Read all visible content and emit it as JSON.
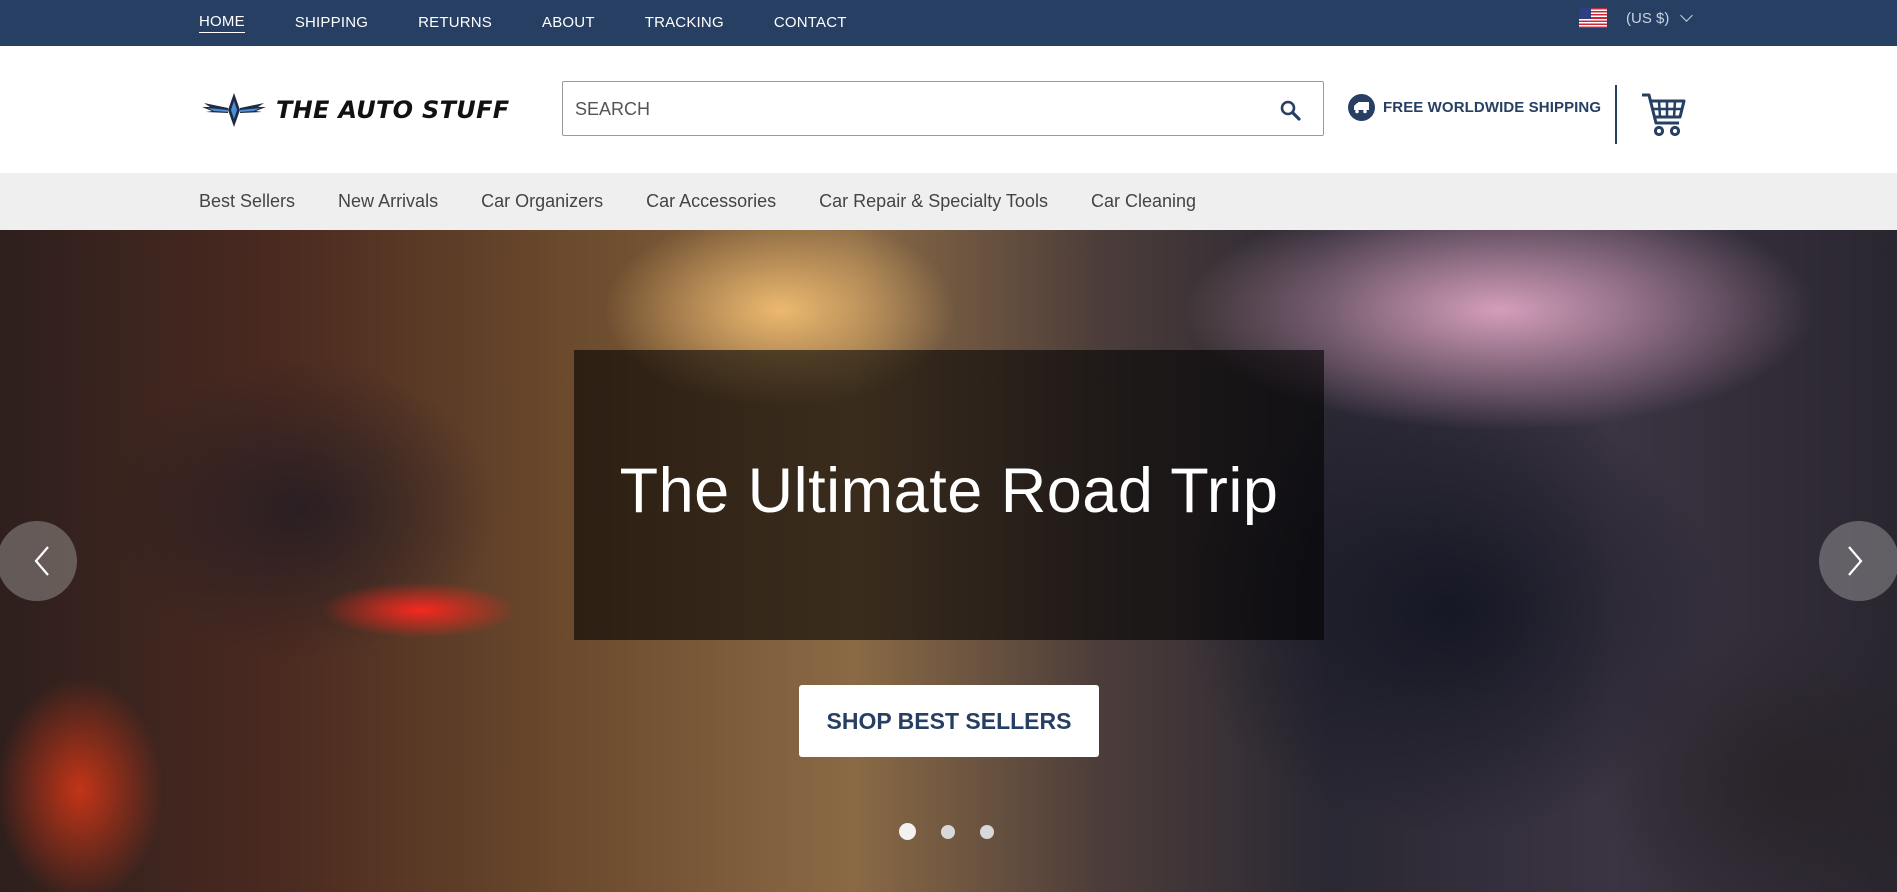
{
  "topbar": {
    "nav": [
      {
        "label": "HOME",
        "active": true
      },
      {
        "label": "SHIPPING"
      },
      {
        "label": "RETURNS"
      },
      {
        "label": "ABOUT"
      },
      {
        "label": "TRACKING"
      },
      {
        "label": "CONTACT"
      }
    ],
    "currency": "(US $)",
    "flag_icon": "us-flag-icon",
    "colors": {
      "background": "#263f62",
      "text": "#ffffff"
    }
  },
  "header": {
    "logo_text": "THE AUTO STUFF",
    "search_placeholder": "SEARCH",
    "search_icon": "search-icon",
    "shipping_text": "FREE WORLDWIDE SHIPPING",
    "shipping_icon": "truck-icon",
    "cart_icon": "cart-icon",
    "colors": {
      "brand": "#263f62"
    }
  },
  "categories": [
    "Best Sellers",
    "New Arrivals",
    "Car Organizers",
    "Car Accessories",
    "Car Repair & Specialty Tools",
    "Car Cleaning"
  ],
  "hero": {
    "title": "The Ultimate Road Trip",
    "button_label": "SHOP BEST SELLERS",
    "slide_count": 3,
    "active_slide": 1,
    "prev_icon": "chevron-left-icon",
    "next_icon": "chevron-right-icon"
  }
}
